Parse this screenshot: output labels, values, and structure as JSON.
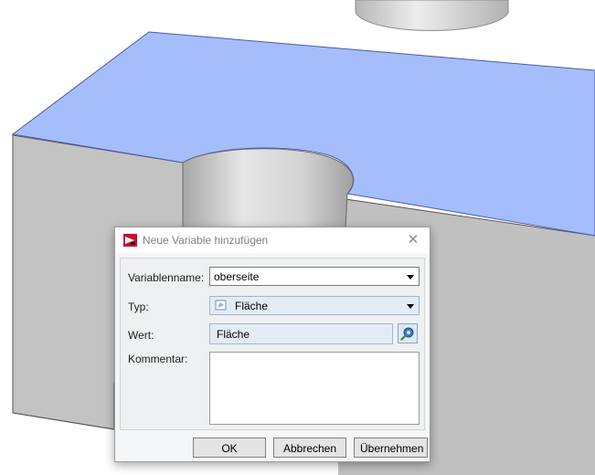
{
  "dialog": {
    "title": "Neue Variable hinzufügen",
    "fields": {
      "name_label": "Variablenname:",
      "name_value": "oberseite",
      "type_label": "Typ:",
      "type_value": "Fläche",
      "value_label": "Wert:",
      "value_value": "Fläche",
      "comment_label": "Kommentar:",
      "comment_value": ""
    },
    "buttons": {
      "ok": "OK",
      "cancel": "Abbrechen",
      "apply": "Übernehmen"
    }
  },
  "colors": {
    "selected_face": "#a5bdfb",
    "model_gray": "#c3c3c3"
  },
  "icons": {
    "title": "app-logo-icon",
    "close": "close-icon",
    "type": "surface-icon",
    "pick": "pick-gear-icon"
  }
}
